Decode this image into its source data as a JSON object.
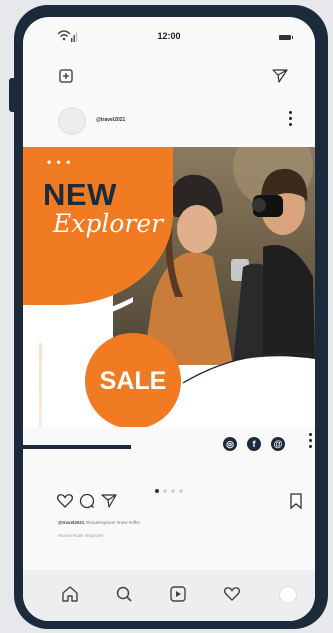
{
  "status_bar": {
    "time": "12:00"
  },
  "post": {
    "username": "@travel2021",
    "headline": "NEW",
    "subheadline": "Explorer",
    "decor_dots": "• • •",
    "sale_label": "SALE",
    "caption_user": "@travel2021",
    "caption_text": "#travelexplorer #new #offer",
    "caption_secondary": "#travel #sale #explorer"
  },
  "social": {
    "instagram_glyph": "◎",
    "facebook_glyph": "f",
    "web_glyph": "@"
  },
  "colors": {
    "accent": "#f07b23",
    "dark": "#1c2b3c"
  }
}
